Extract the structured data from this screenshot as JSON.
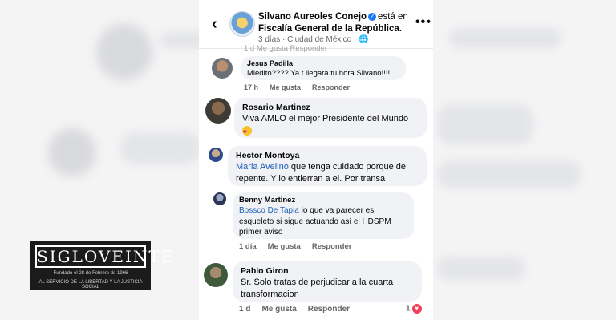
{
  "header": {
    "back": "‹",
    "author": "Silvano Aureoles Conejo",
    "verb": "está en",
    "place": "Fiscalía General de la República.",
    "meta": "3 días · Ciudad de México · 🌐",
    "more": "•••"
  },
  "ghost_row": "1 d     Me gusta     Responder",
  "comments": [
    {
      "name": "Jesus Padilla",
      "text": "Miedito???? Ya t llegara tu hora Silvano!!!!",
      "time": "17 h",
      "like": "Me gusta",
      "reply": "Responder"
    },
    {
      "name": "Rosario Martinez",
      "text": "Viva AMLO el mejor Presidente del Mundo",
      "emoji": "heart-eyes-emoji"
    },
    {
      "name": "Hector Montoya",
      "mention": "Maria Avelino",
      "text": " que tenga cuidado porque de repente. Y lo entierran a el. Por transa"
    },
    {
      "name": "Benny Martinez",
      "mention": "Bossco De Tapia",
      "text": " lo que va parecer es esqueleto si sigue actuando así el HDSPM primer aviso",
      "time": "1 día",
      "like": "Me gusta",
      "reply": "Responder"
    },
    {
      "name": "Pablo Giron",
      "text": "Sr. Solo tratas de perjudicar a la cuarta transformacion",
      "time": "1 d",
      "like": "Me gusta",
      "reply": "Responder",
      "reactions": "1"
    }
  ],
  "logo": {
    "word": "SIGLOVEINTE",
    "line1": "Fundado el 28 de Febrero de 1966",
    "line2": "AL SERVICIO DE LA LIBERTAD Y LA JUSTICIA SOCIAL"
  },
  "colors": {
    "mention": "#1d5fb8",
    "bubble": "#f0f2f5",
    "verified": "#1877f2"
  }
}
